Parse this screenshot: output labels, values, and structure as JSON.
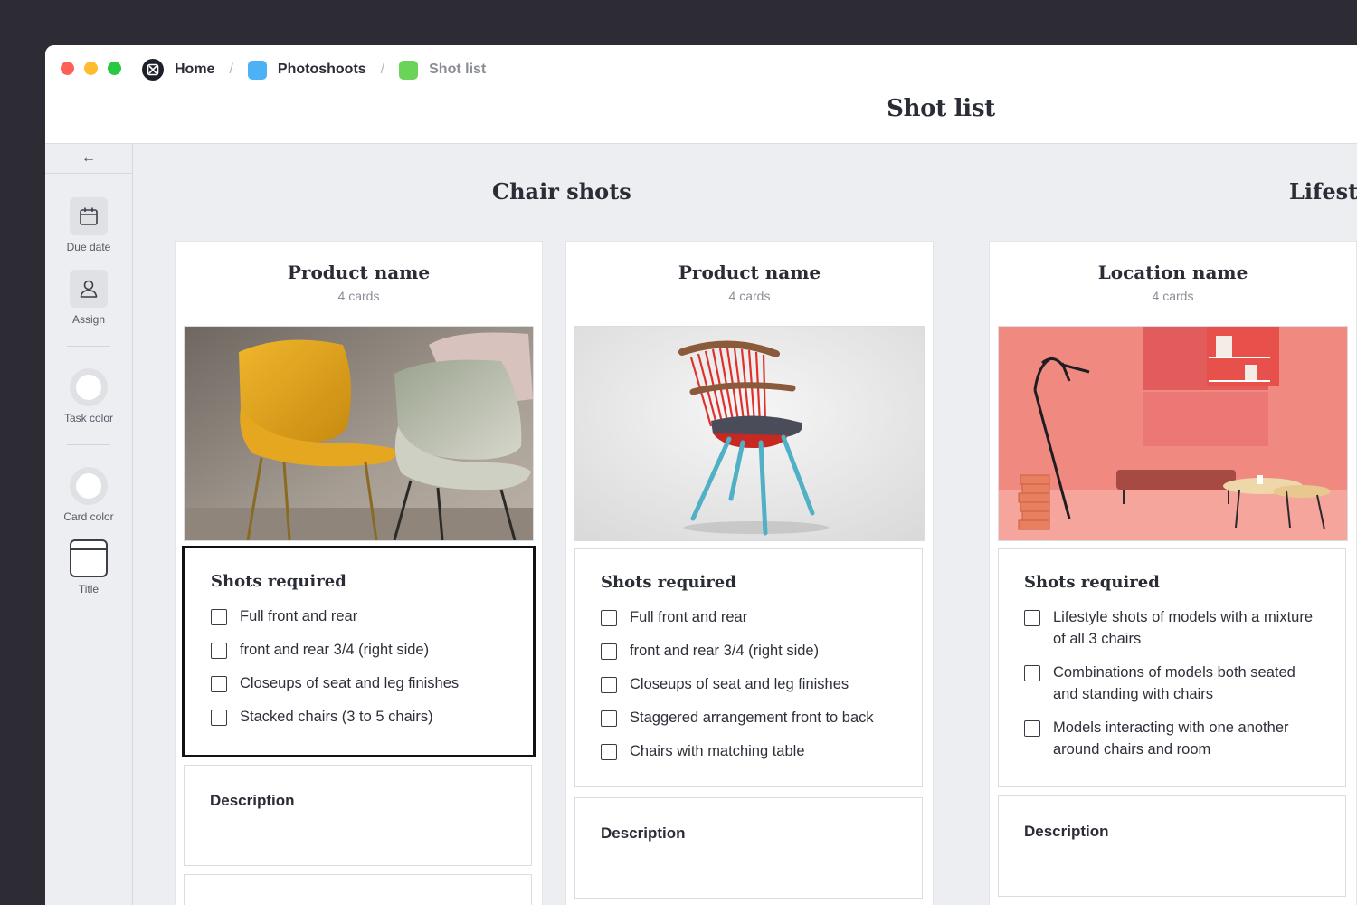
{
  "window": {
    "breadcrumbs": [
      {
        "label": "Home",
        "icon": "home-logo-icon"
      },
      {
        "label": "Photoshoots",
        "color": "#4cb2f5"
      },
      {
        "label": "Shot list",
        "color": "#6bd25a"
      }
    ],
    "title": "Shot list"
  },
  "sidebar": {
    "back_icon": "←",
    "tools": [
      {
        "label": "Due date",
        "icon": "calendar-icon"
      },
      {
        "label": "Assign",
        "icon": "person-icon"
      },
      {
        "label": "Task color",
        "icon": "color-circle-icon"
      },
      {
        "label": "Card color",
        "icon": "color-circle-icon"
      },
      {
        "label": "Title",
        "icon": "title-card-icon"
      }
    ]
  },
  "groups": [
    {
      "title": "Chair shots"
    },
    {
      "title": "Lifesty"
    }
  ],
  "columns": [
    {
      "name": "Product name",
      "count": "4 cards",
      "image": "yellow and grey plastic chairs",
      "shots_title": "Shots required",
      "shots": [
        "Full front and rear",
        "front and rear 3/4 (right side)",
        "Closeups of seat and leg finishes",
        "Stacked chairs (3 to 5 chairs)"
      ],
      "description_title": "Description"
    },
    {
      "name": "Product name",
      "count": "4 cards",
      "image": "red spindle-back chair with blue legs",
      "shots_title": "Shots required",
      "shots": [
        "Full front and rear",
        "front and rear 3/4 (right side)",
        "Closeups of seat and leg finishes",
        "Staggered arrangement front to back",
        "Chairs with matching table"
      ],
      "description_title": "Description"
    },
    {
      "name": "Location name",
      "count": "4 cards",
      "image": "pink room with bench and coat rack",
      "shots_title": "Shots required",
      "shots": [
        "Lifestyle shots of models with a mixture of all 3 chairs",
        "Combinations of models both seated and standing with chairs",
        "Models interacting with one another around chairs and room"
      ],
      "description_title": "Description"
    }
  ]
}
